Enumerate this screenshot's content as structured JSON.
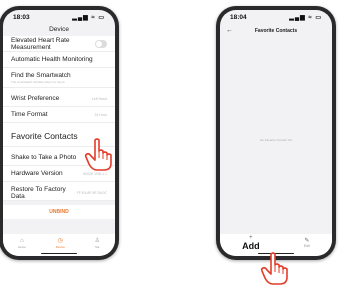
{
  "left_screen": {
    "time": "18:03",
    "status_icons": "▂▄▆ ≈ ▭",
    "title": "Device",
    "rows": [
      {
        "label": "Elevated Heart Rate Measurement"
      },
      {
        "label": "Automatic Health Monitoring"
      },
      {
        "label": "Find the Smartwatch",
        "sub": "The smartwatch vibrates when it's found"
      },
      {
        "label": "Wrist Preference",
        "value": "Left Hand"
      },
      {
        "label": "Time Format",
        "value": "24 Hour"
      },
      {
        "label": "Favorite Contacts"
      },
      {
        "label": "Shake to Take a Photo"
      },
      {
        "label": "Hardware Version",
        "value": "IM02E-V0B-1.1"
      },
      {
        "label": "Restore To Factory Data",
        "value": "FF:EA:8F:8F:36:0C"
      }
    ],
    "unbind_label": "UNBIND",
    "tabs": [
      {
        "label": "Home",
        "icon": "⌂"
      },
      {
        "label": "Device",
        "icon": "◷"
      },
      {
        "label": "Me",
        "icon": "♙"
      }
    ],
    "accent_color": "#e8792e"
  },
  "right_screen": {
    "time": "18:04",
    "status_icons": "▂▄▆ ≈ ▭",
    "back_icon": "←",
    "title": "Favorite Contacts",
    "empty_text": "No Favorite Contact Yet",
    "add_icon": "+",
    "add_label": "Add",
    "edit_icon": "✎",
    "edit_label": "Edit"
  }
}
